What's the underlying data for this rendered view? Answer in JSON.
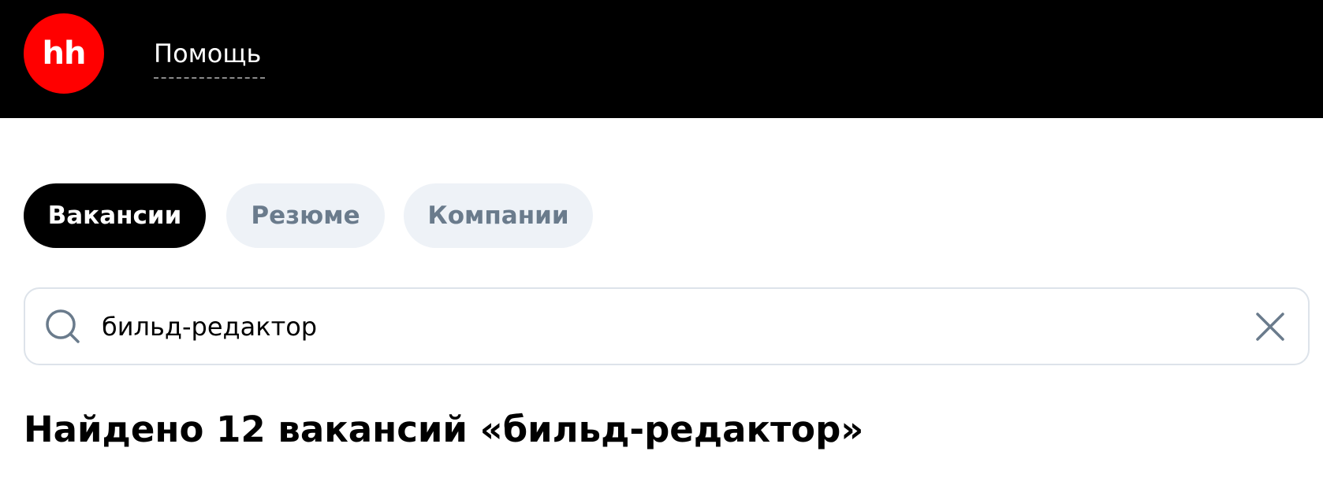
{
  "header": {
    "logo_text": "hh",
    "help_label": "Помощь"
  },
  "tabs": [
    {
      "label": "Вакансии",
      "active": true
    },
    {
      "label": "Резюме",
      "active": false
    },
    {
      "label": "Компании",
      "active": false
    }
  ],
  "search": {
    "value": "бильд-редактор",
    "icon": "search-icon",
    "clear_icon": "close-icon"
  },
  "results": {
    "title": "Найдено 12 вакансий «бильд-редактор»"
  },
  "colors": {
    "header_bg": "#000000",
    "logo_bg": "#ff0000",
    "tab_active_bg": "#000000",
    "tab_inactive_bg": "#eef2f7",
    "tab_inactive_text": "#6a7b8c",
    "search_border": "#dde3ea",
    "icon_color": "#6a7b8c"
  }
}
